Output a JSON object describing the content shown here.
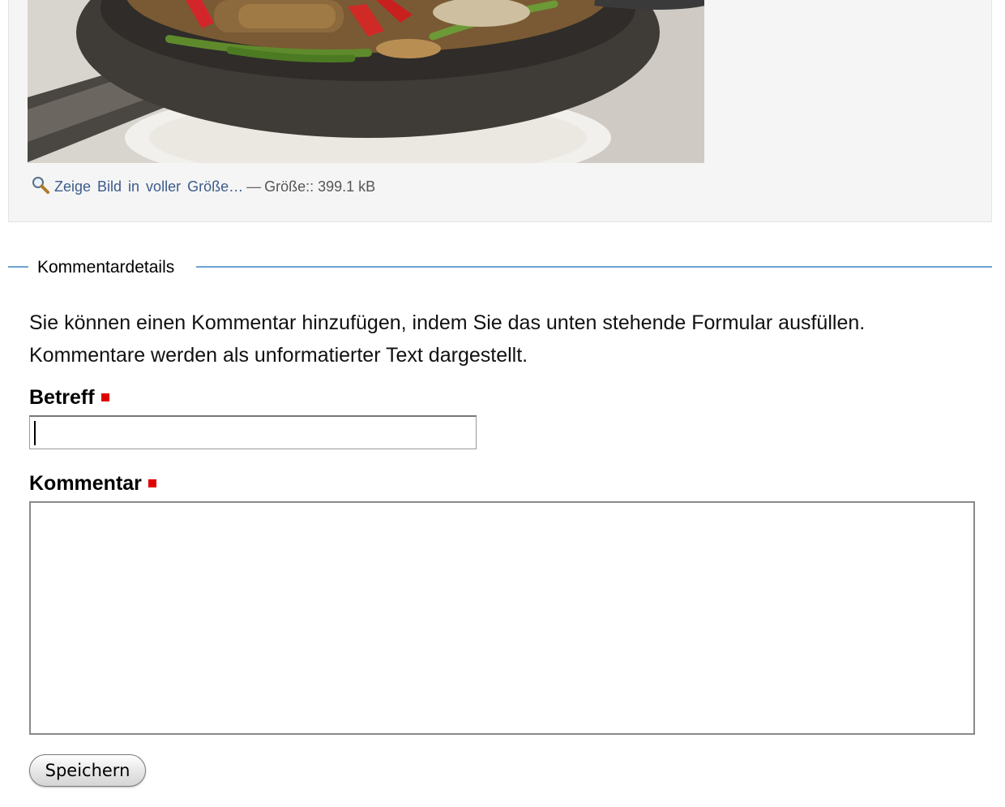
{
  "image_section": {
    "photo_alt": "Gericht in gusseiserner Pfanne",
    "zoom_icon": "magnifier-icon",
    "full_size_link": "Zeige Bild in voller Größe…",
    "separator": "—",
    "size_text": "Größe:: 399.1 kB"
  },
  "comment_form": {
    "legend": "Kommentardetails",
    "help_text": "Sie können einen Kommentar hinzufügen, indem Sie das unten stehende Formular ausfüllen. Kommentare werden als unformatierter Text dargestellt.",
    "subject_label": "Betreff",
    "subject_value": "",
    "comment_label": "Kommentar",
    "comment_value": "",
    "save_label": "Speichern"
  },
  "colors": {
    "required_marker": "#e00000",
    "legend_line": "#6fa3cf",
    "link": "#3b5b8d"
  }
}
